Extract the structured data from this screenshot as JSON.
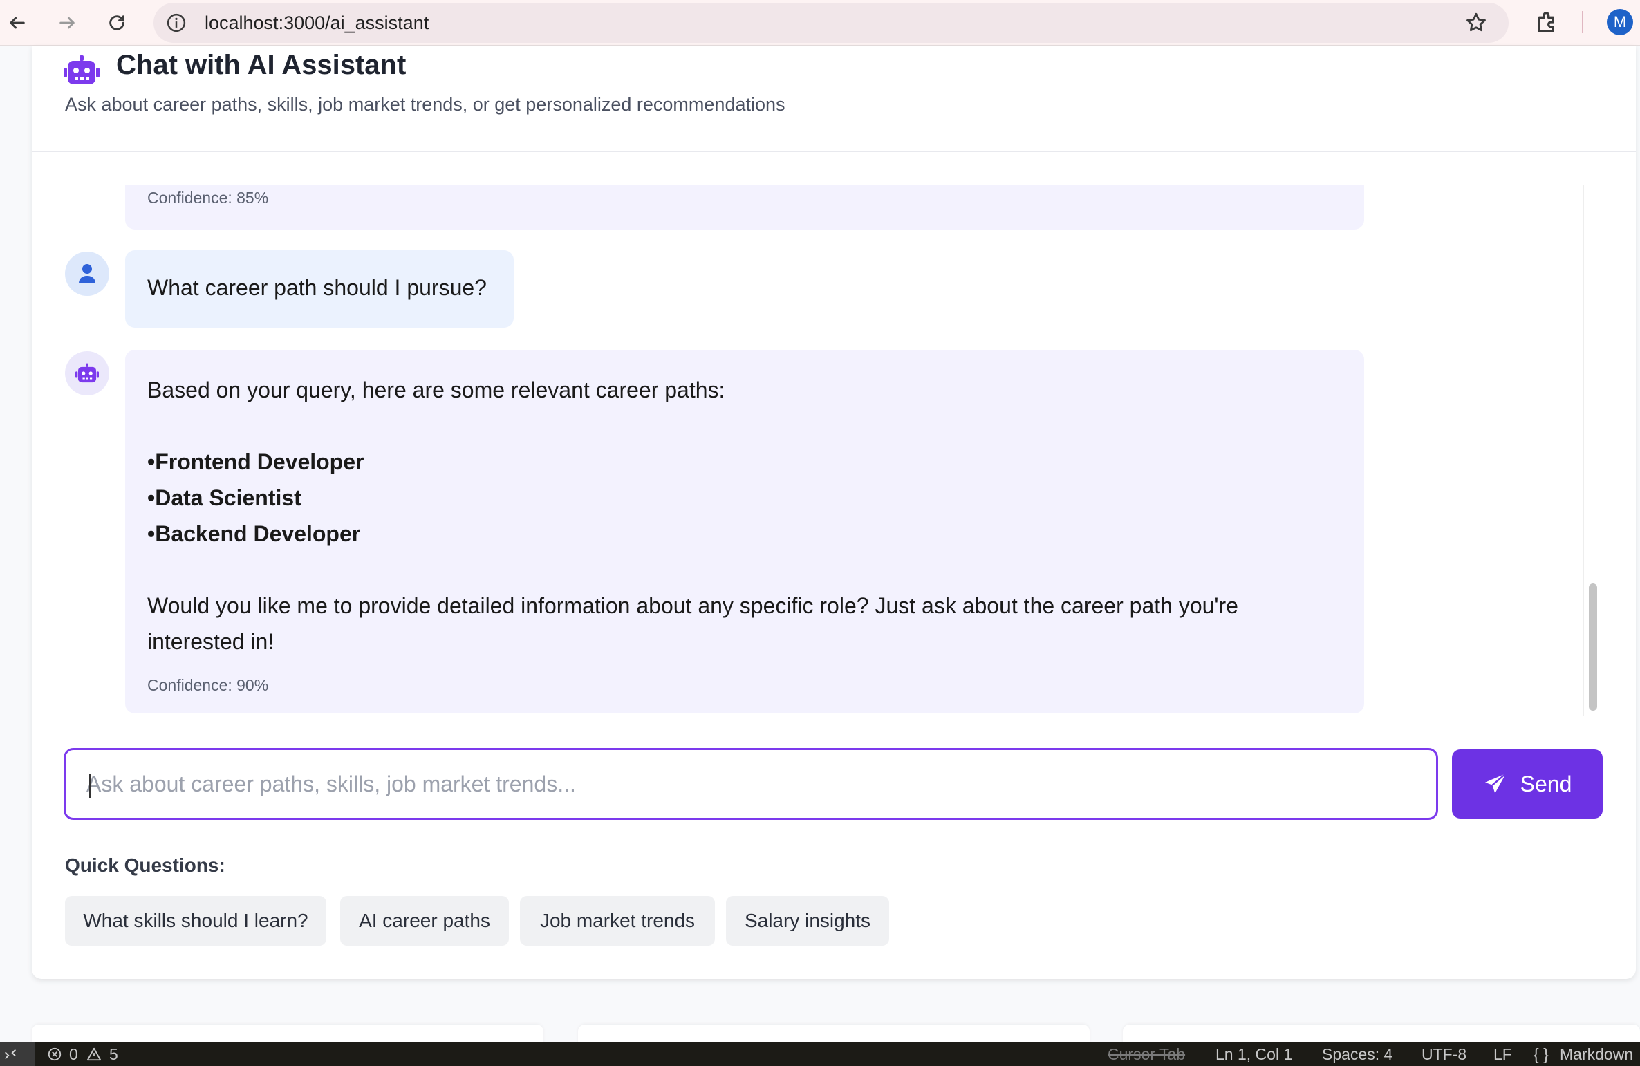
{
  "browser": {
    "url": "localhost:3000/ai_assistant",
    "profile_initial": "M"
  },
  "chat": {
    "title": "Chat with AI Assistant",
    "subtitle": "Ask about career paths, skills, job market trends, or get personalized recommendations"
  },
  "messages": {
    "prev_ai_confidence": "Confidence: 85%",
    "user_message": "What career path should I pursue?",
    "ai_intro": "Based on your query, here are some relevant career paths:",
    "ai_paths": [
      "Frontend Developer",
      "Data Scientist",
      "Backend Developer"
    ],
    "ai_bullet": "•",
    "ai_followup_line1": "Would you like me to provide detailed information about any specific role? Just ask about the career path you're",
    "ai_followup_line2": "interested in!",
    "ai_confidence": "Confidence: 90%"
  },
  "input": {
    "placeholder": "Ask about career paths, skills, job market trends...",
    "value": "",
    "send_label": "Send"
  },
  "quick_questions": {
    "label": "Quick Questions:",
    "items": [
      "What skills should I learn?",
      "AI career paths",
      "Job market trends",
      "Salary insights"
    ]
  },
  "status_bar": {
    "errors": "0",
    "warnings": "5",
    "cursor_tab": "Cursor Tab",
    "position": "Ln 1, Col 1",
    "spaces": "Spaces: 4",
    "encoding": "UTF-8",
    "eol": "LF",
    "language": "Markdown"
  },
  "colors": {
    "accent": "#6d32e4",
    "ai_bubble": "#f3f2fe",
    "user_bubble": "#ebf2fe"
  }
}
